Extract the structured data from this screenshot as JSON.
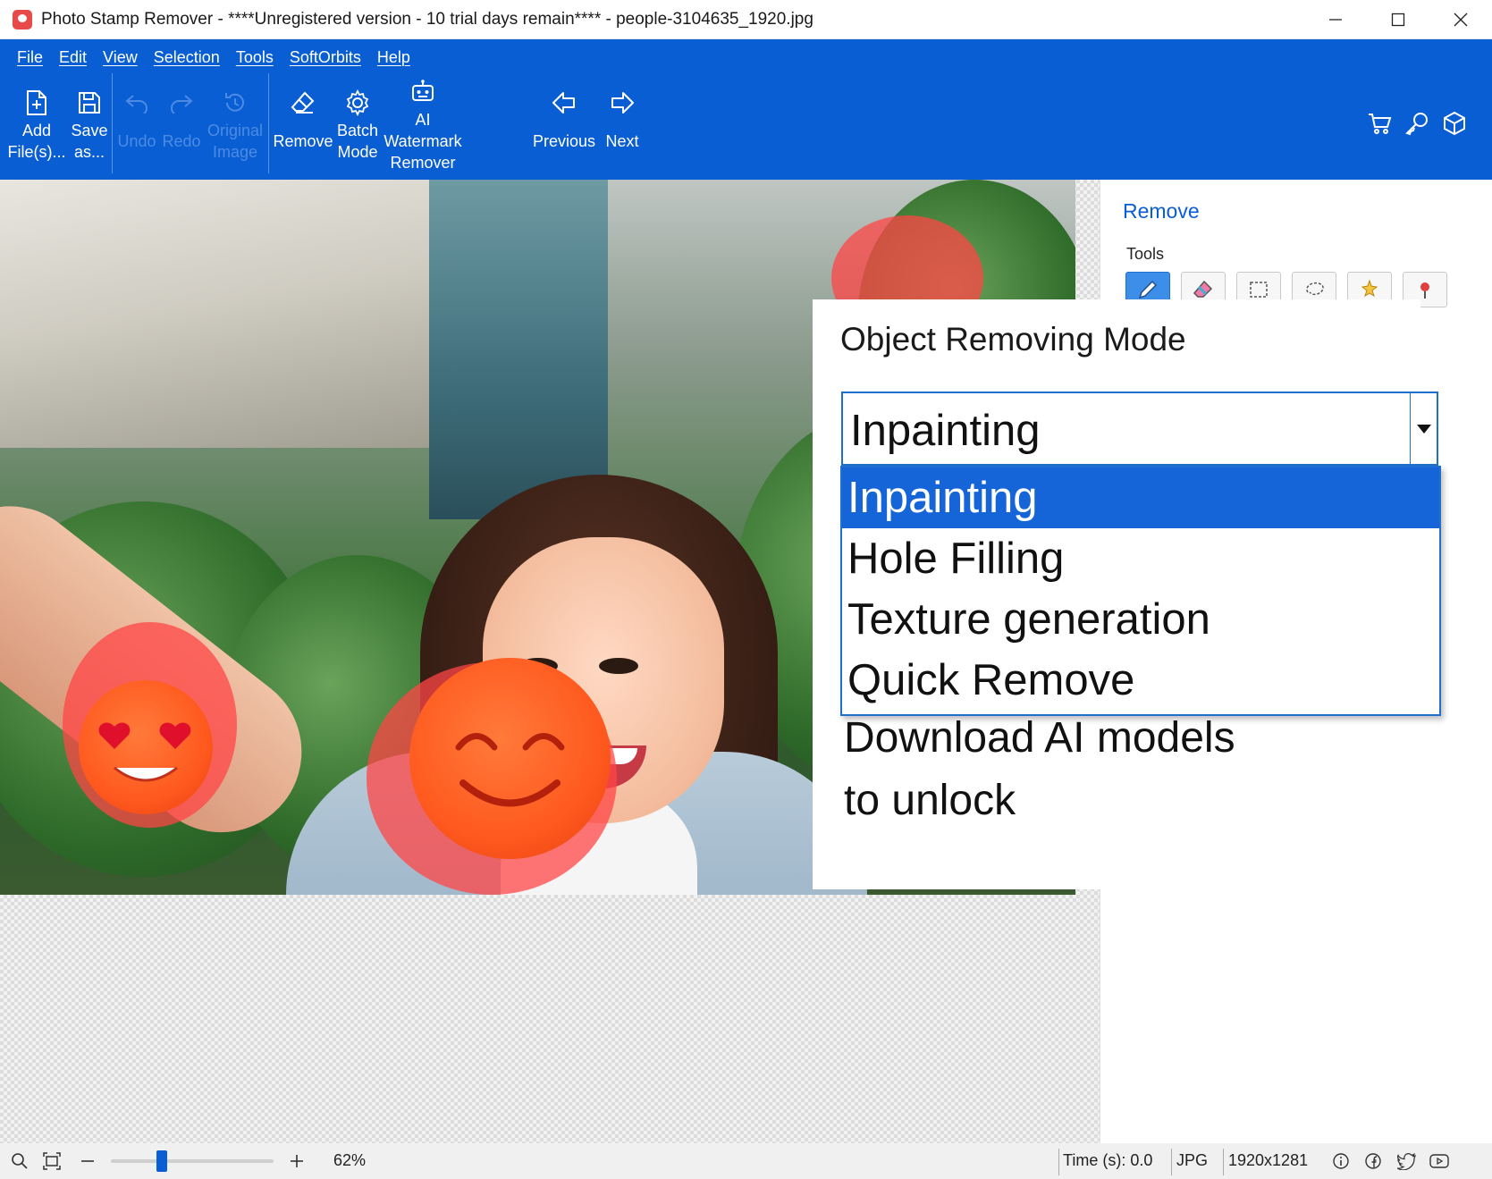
{
  "window": {
    "title": "Photo Stamp Remover - ****Unregistered version - 10 trial days remain**** - people-3104635_1920.jpg",
    "controls": [
      "minimize-icon",
      "maximize-icon",
      "close-icon"
    ]
  },
  "menu": {
    "items": [
      "File",
      "Edit",
      "View",
      "Selection",
      "Tools",
      "SoftOrbits",
      "Help"
    ]
  },
  "toolbar": {
    "add_line1": "Add",
    "add_line2": "File(s)...",
    "save_line1": "Save",
    "save_line2": "as...",
    "undo": "Undo",
    "redo": "Redo",
    "original_line1": "Original",
    "original_line2": "Image",
    "remove": "Remove",
    "batch_line1": "Batch",
    "batch_line2": "Mode",
    "ai_line1": "AI",
    "ai_line2": "Watermark",
    "ai_line3": "Remover",
    "previous": "Previous",
    "next": "Next",
    "right_icons": [
      "cart-icon",
      "key-icon",
      "box-icon"
    ]
  },
  "panel": {
    "title": "Remove",
    "tools_label": "Tools",
    "tools": [
      "pencil-icon",
      "eraser-icon",
      "rectangle-select-icon",
      "lasso-icon",
      "magic-wand-icon",
      "marker-pin-icon"
    ],
    "active_tool": "pencil-icon"
  },
  "callout": {
    "title": "Object Removing Mode",
    "selected": "Inpainting",
    "options": [
      "Inpainting",
      "Hole Filling",
      "Texture generation",
      "Quick Remove"
    ],
    "note_line1": "Download AI models",
    "note_line2": "to unlock"
  },
  "status": {
    "zoom": "62%",
    "zoom_level": 0.3,
    "time": "Time (s): 0.0",
    "format": "JPG",
    "dimensions": "1920x1281",
    "icons": [
      "info-icon",
      "facebook-icon",
      "twitter-icon",
      "youtube-icon"
    ]
  },
  "colors": {
    "accent": "#0a5ed3",
    "selected_option": "#1565d8",
    "emoji": "#ff5a1f",
    "marker_overlay": "#ff4646"
  }
}
